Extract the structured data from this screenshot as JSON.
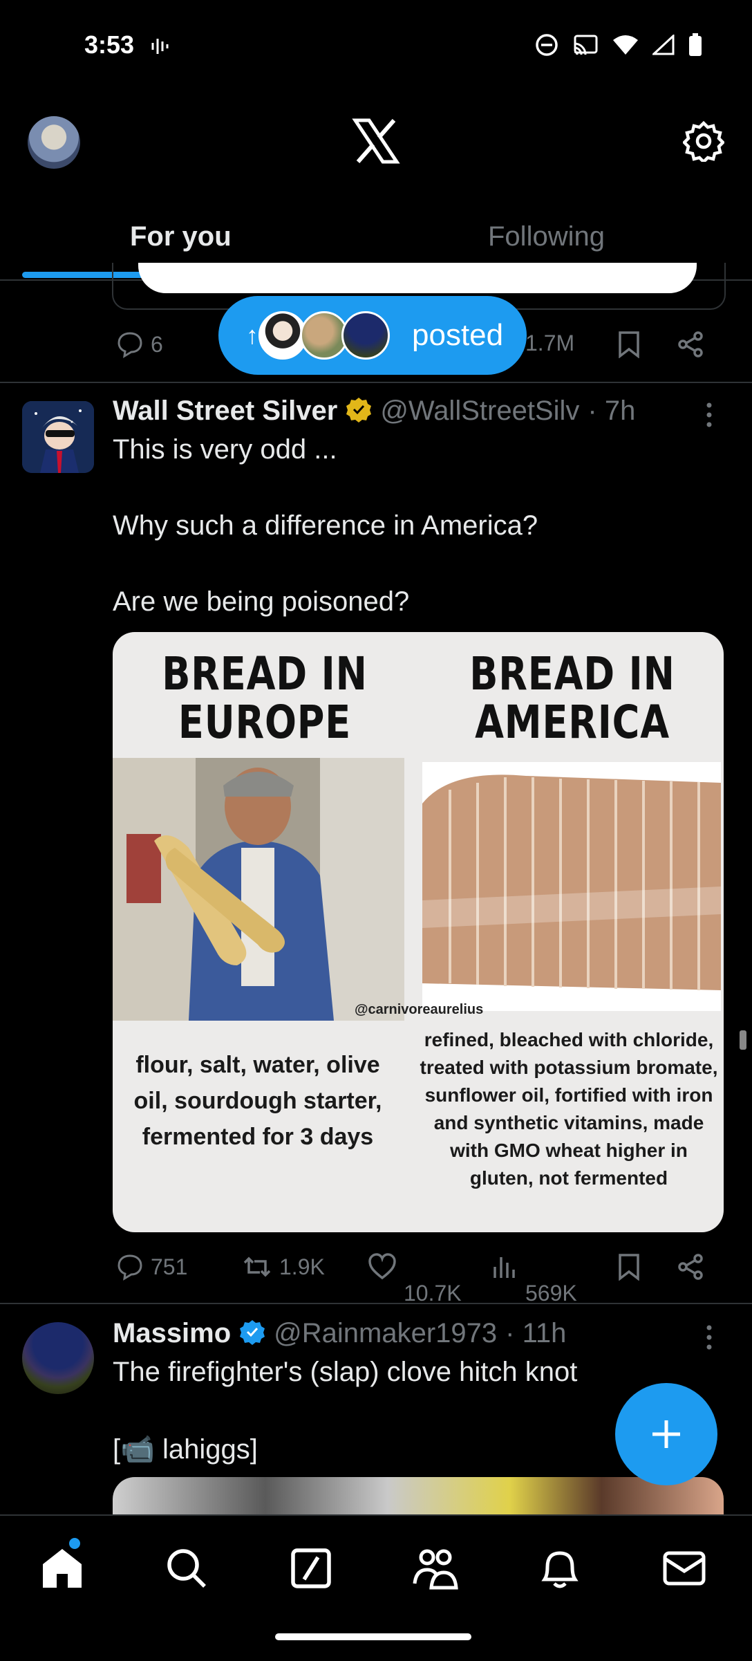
{
  "status_bar": {
    "time": "3:53"
  },
  "header": {
    "tabs": [
      {
        "label": "For you",
        "active": true
      },
      {
        "label": "Following",
        "active": false
      }
    ]
  },
  "previous_post": {
    "replies": "6",
    "views": "1.7M"
  },
  "new_posts_pill": {
    "label": "posted"
  },
  "tweets": [
    {
      "name": "Wall Street Silver",
      "verified": "gold",
      "handle": "@WallStreetSilv",
      "time": "· 7h",
      "lines": [
        "This is very odd ...",
        "Why such a difference in America?",
        "Are we being poisoned?"
      ],
      "image": {
        "left_heading": "BREAD IN EUROPE",
        "right_heading": "BREAD IN AMERICA",
        "watermark": "@carnivoreaurelius",
        "left_text": "flour, salt, water, olive oil, sourdough starter, fermented for 3 days",
        "right_text": "refined, bleached with chloride, treated with potassium bromate, sunflower oil, fortified with iron and synthetic vitamins, made with GMO wheat higher in gluten, not fermented"
      },
      "stats": {
        "replies": "751",
        "reposts": "1.9K",
        "likes": "10.7K",
        "views": "569K"
      }
    },
    {
      "name": "Massimo",
      "verified": "blue",
      "handle": "@Rainmaker1973",
      "time": "· 11h",
      "lines": [
        "The firefighter's (slap) clove hitch knot",
        "[📹 lahiggs]"
      ]
    }
  ],
  "colors": {
    "accent": "#1d9bf0",
    "muted": "#71767b",
    "divider": "#2f3336",
    "gold": "#e2b719"
  }
}
